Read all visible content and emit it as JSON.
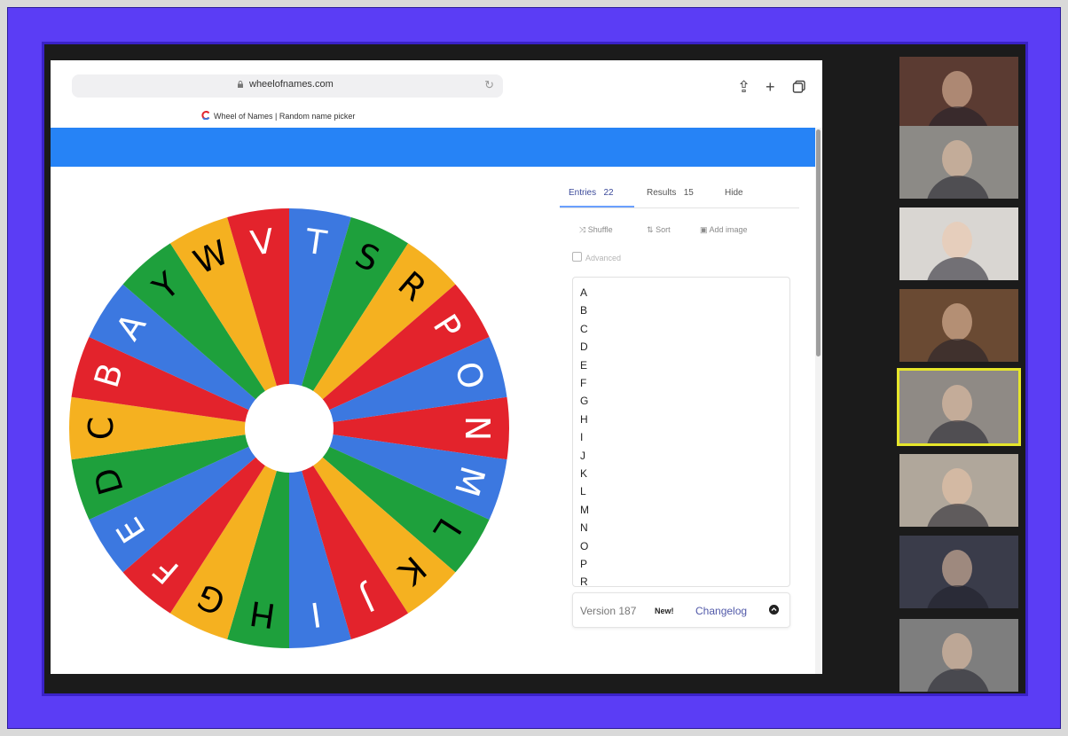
{
  "browser": {
    "url": "wheelofnames.com",
    "tab_title": "Wheel of Names | Random name picker",
    "reload_icon": "reload-icon",
    "share_icon": "share-icon",
    "new_tab_icon": "plus-icon",
    "tabs_icon": "tabs-icon"
  },
  "wheel": {
    "segments": [
      "N",
      "M",
      "L",
      "K",
      "J",
      "I",
      "H",
      "G",
      "F",
      "E",
      "D",
      "C",
      "B",
      "A",
      "Y",
      "W",
      "V",
      "T",
      "S",
      "R",
      "P",
      "O"
    ],
    "colors": [
      "#e3232c",
      "#3c78e0",
      "#1ea03c",
      "#f5b120"
    ],
    "pointer_color": "#c7c7c7"
  },
  "panel": {
    "tabs": [
      {
        "label": "Entries",
        "count": "22"
      },
      {
        "label": "Results",
        "count": "15"
      },
      {
        "label": "Hide",
        "count": ""
      }
    ],
    "tools": {
      "shuffle": "Shuffle",
      "sort": "Sort",
      "add_image": "Add image"
    },
    "advanced_label": "Advanced",
    "entries": [
      "A",
      "B",
      "C",
      "D",
      "E",
      "F",
      "G",
      "H",
      "I",
      "J",
      "K",
      "L",
      "M",
      "N",
      "O",
      "P",
      "R"
    ],
    "version": "Version 187",
    "new_badge": "New!",
    "changelog": "Changelog"
  },
  "participants": [
    {
      "bg": "#5b3b32"
    },
    {
      "bg": "#8c8a86"
    },
    {
      "bg": "#d9d6d2"
    },
    {
      "bg": "#6a4a33"
    },
    {
      "bg": "#8f8a85",
      "active": true
    },
    {
      "bg": "#b0a79b"
    },
    {
      "bg": "#3a3c4a"
    },
    {
      "bg": "#7e7e7e"
    }
  ]
}
